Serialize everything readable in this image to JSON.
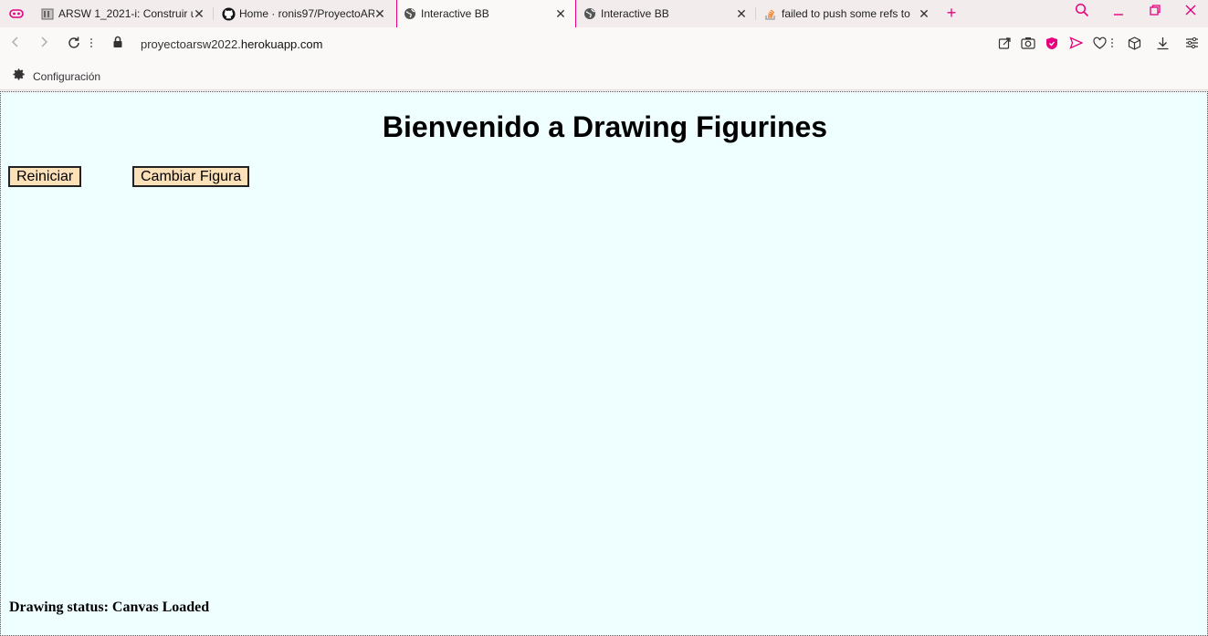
{
  "tabs": [
    {
      "title": "ARSW 1_2021-i: Construir u",
      "icon": "moodle-icon",
      "active": false
    },
    {
      "title": "Home · ronis97/ProyectoAR",
      "icon": "github-icon",
      "active": false
    },
    {
      "title": "Interactive BB",
      "icon": "globe-icon",
      "active": true
    },
    {
      "title": "Interactive BB",
      "icon": "globe-icon",
      "active": false
    },
    {
      "title": "failed to push some refs to",
      "icon": "stackoverflow-icon",
      "active": false
    }
  ],
  "address": {
    "url_prefix": "proyectoarsw2022.",
    "url_domain": "herokuapp.com"
  },
  "bookmarks": {
    "settings_label": "Configuración"
  },
  "page": {
    "heading": "Bienvenido a Drawing Figurines",
    "reset_button": "Reiniciar",
    "change_figure_button": "Cambiar Figura",
    "status": "Drawing status: Canvas Loaded"
  },
  "colors": {
    "accent": "#e6007e",
    "page_bg": "#efffff",
    "button_bg": "#fbe0b8"
  }
}
